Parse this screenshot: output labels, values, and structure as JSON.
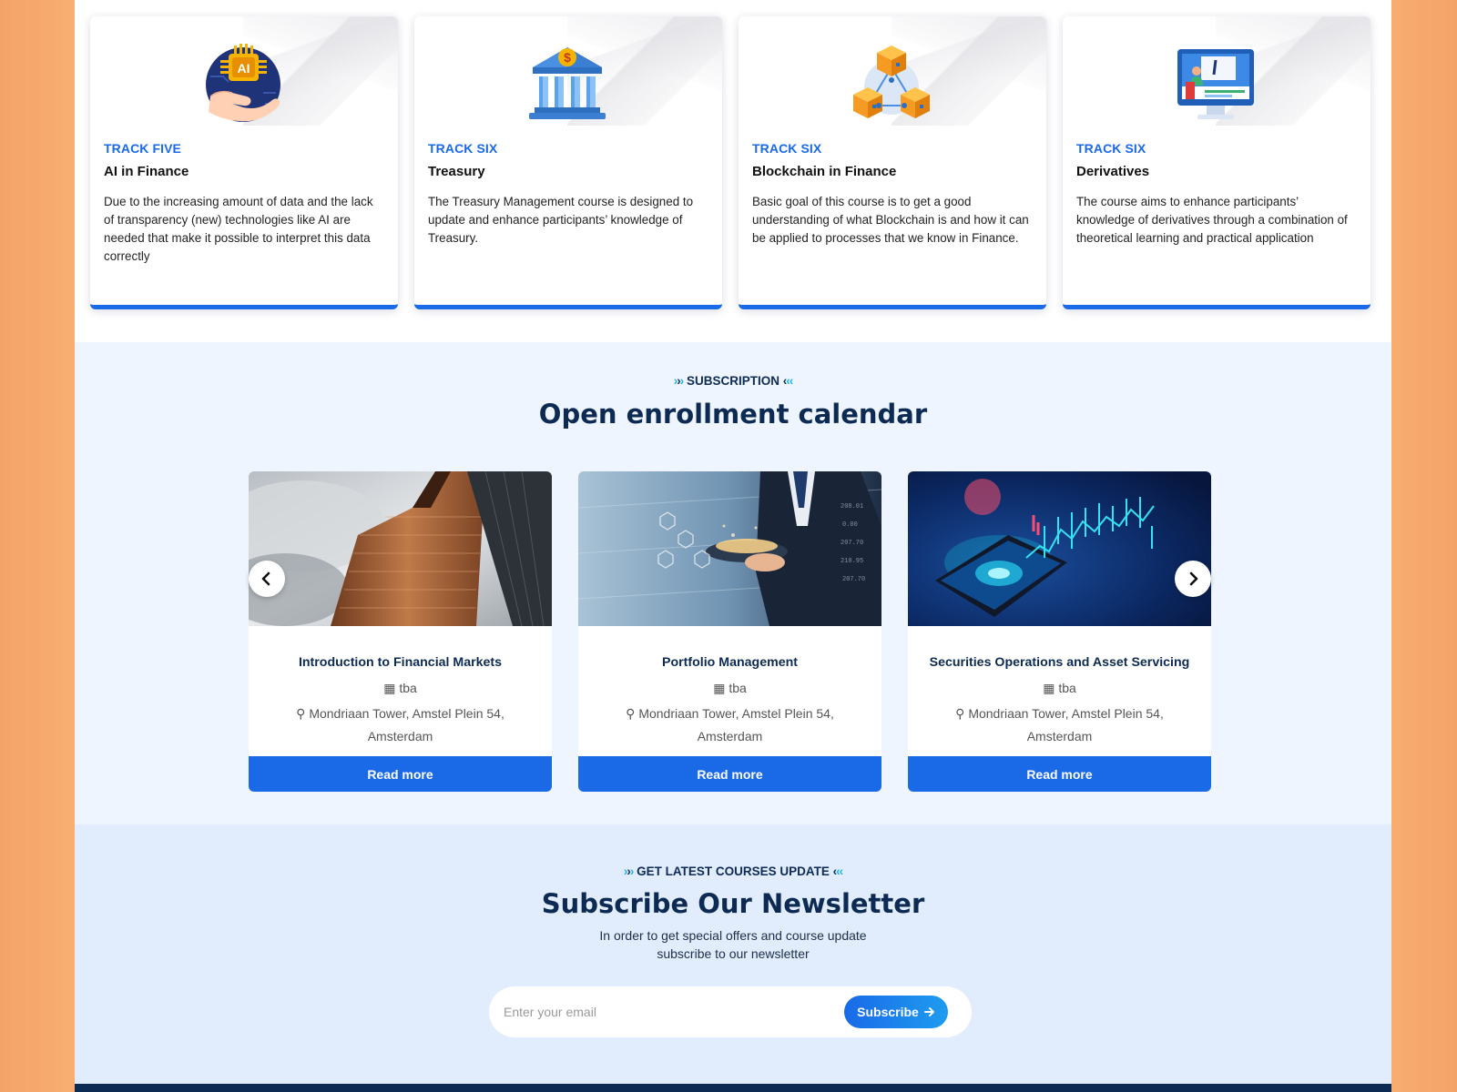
{
  "tracks": [
    {
      "eyebrow": "TRACK FIVE",
      "title": "AI in Finance",
      "description": "Due to the increasing amount of data and the lack of transparency (new) technologies like AI are needed that make it possible to interpret this data correctly",
      "icon": "ai-chip-hand-icon",
      "icon_text": "AI"
    },
    {
      "eyebrow": "TRACK SIX",
      "title": "Treasury",
      "description": "The Treasury Management course is designed to update and enhance participants’ knowledge of Treasury.",
      "icon": "bank-building-icon",
      "icon_text": "$"
    },
    {
      "eyebrow": "TRACK SIX",
      "title": "Blockchain in Finance",
      "description": "Basic goal of this course is to get a good understanding of what Blockchain is and how it can be applied to processes that we know in Finance.",
      "icon": "blockchain-cubes-icon"
    },
    {
      "eyebrow": "TRACK SIX",
      "title": "Derivatives",
      "description": "The course aims to enhance participants’ knowledge of derivatives through a combination of theoretical learning and practical application",
      "icon": "presentation-monitor-icon"
    }
  ],
  "enrollment": {
    "kicker": "SUBSCRIPTION",
    "heading": "Open enrollment calendar",
    "courses": [
      {
        "title": "Introduction to Financial Markets",
        "date": "tba",
        "location": "Mondriaan Tower, Amstel Plein 54, Amsterdam",
        "button": "Read more",
        "image": "skyscraper-photo"
      },
      {
        "title": "Portfolio Management",
        "date": "tba",
        "location": "Mondriaan Tower, Amstel Plein 54, Amsterdam",
        "button": "Read more",
        "image": "businessman-tablet-photo"
      },
      {
        "title": "Securities Operations and Asset Servicing",
        "date": "tba",
        "location": "Mondriaan Tower, Amstel Plein 54, Amsterdam",
        "button": "Read more",
        "image": "smartphone-chart-photo"
      }
    ],
    "prev_icon": "chevron-left-icon",
    "next_icon": "chevron-right-icon"
  },
  "newsletter": {
    "kicker": "GET LATEST COURSES UPDATE",
    "heading": "Subscribe Our Newsletter",
    "subtext_line1": "In order to get special offers and course update",
    "subtext_line2": "subscribe to our newsletter",
    "email_placeholder": "Enter your email",
    "button": "Subscribe"
  },
  "colors": {
    "accent": "#1a6ae8",
    "navy": "#0c2a52",
    "page_frame": "#f8ae72",
    "enroll_bg": "#eff5fe",
    "newsletter_bg": "#e1ecfd"
  }
}
